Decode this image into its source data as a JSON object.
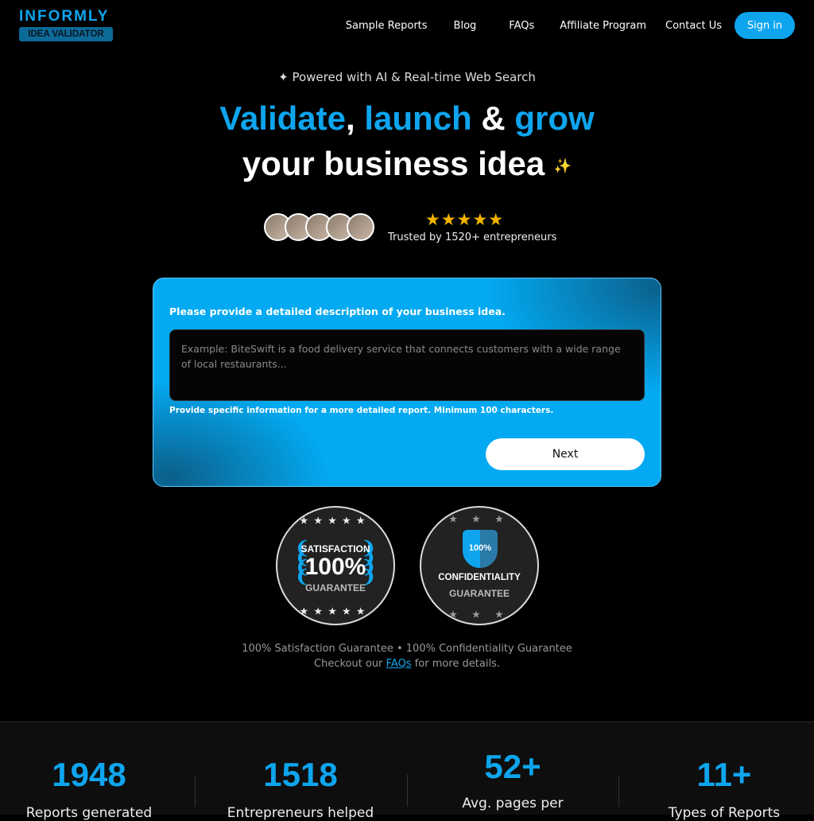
{
  "brand": {
    "name": "INFORMLY",
    "badge": "IDEA VALIDATOR"
  },
  "nav": {
    "items": [
      "Sample Reports",
      "Blog",
      "FAQs",
      "Affiliate Program",
      "Contact Us"
    ],
    "signin": "Sign in"
  },
  "hero": {
    "powered": "Powered with AI & Real-time Web Search",
    "title_validate": "Validate",
    "comma": ",",
    "title_launch": "launch",
    "amp": "&",
    "title_grow": "grow",
    "title_line2": "your business idea",
    "stars": "★★★★★",
    "trusted": "Trusted by 1520+ entrepreneurs"
  },
  "form": {
    "label": "Please provide a detailed description of your business idea.",
    "placeholder": "Example: BiteSwift is a food delivery service that connects customers with a wide range of local restaurants...",
    "hint": "Provide specific information for a more detailed report. Minimum 100 characters.",
    "next": "Next"
  },
  "badges": {
    "sat_top": "SATISFACTION",
    "sat_pct": "100%",
    "sat_bottom": "GUARANTEE",
    "conf_pct": "100%",
    "conf_top": "CONFIDENTIALITY",
    "conf_bottom": "GUARANTEE"
  },
  "footer": {
    "line1": "100% Satisfaction Guarantee • 100% Confidentiality Guarantee",
    "pre": "Checkout our ",
    "link": "FAQs",
    "post": " for more details."
  },
  "stats": [
    {
      "num": "1948",
      "label": "Reports generated"
    },
    {
      "num": "1518",
      "label": "Entrepreneurs helped"
    },
    {
      "num": "52+",
      "label": "Avg. pages per"
    },
    {
      "num": "11+",
      "label": "Types of Reports"
    }
  ],
  "colors": {
    "accent": "#0ea5ee",
    "star": "#f5b400"
  }
}
